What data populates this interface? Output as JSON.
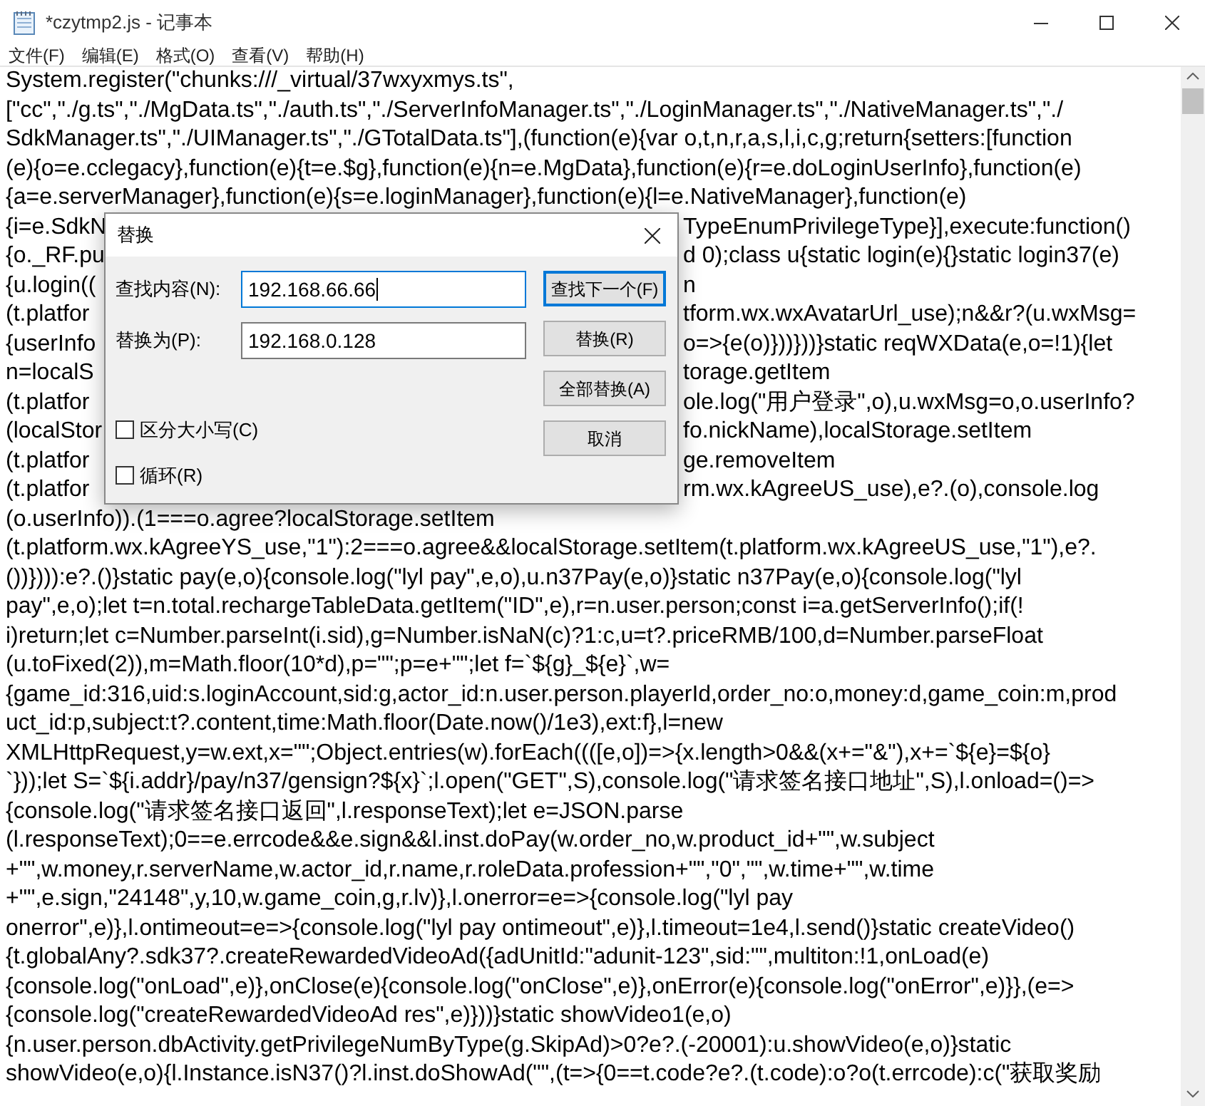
{
  "window": {
    "title": "*czytmp2.js - 记事本"
  },
  "menu": [
    "文件(F)",
    "编辑(E)",
    "格式(O)",
    "查看(V)",
    "帮助(H)"
  ],
  "editor": {
    "lines": [
      {
        "kind": "full",
        "text": "System.register(\"chunks:///_virtual/37wxyxmys.ts\","
      },
      {
        "kind": "full",
        "text": "[\"cc\",\"./g.ts\",\"./MgData.ts\",\"./auth.ts\",\"./ServerInfoManager.ts\",\"./LoginManager.ts\",\"./NativeManager.ts\",\"./"
      },
      {
        "kind": "full",
        "text": "SdkManager.ts\",\"./UIManager.ts\",\"./GTotalData.ts\"],(function(e){var o,t,n,r,a,s,l,i,c,g;return{setters:[function"
      },
      {
        "kind": "full",
        "text": "(e){o=e.cclegacy},function(e){t=e.$g},function(e){n=e.MgData},function(e){r=e.doLoginUserInfo},function(e)"
      },
      {
        "kind": "full",
        "text": "{a=e.serverManager},function(e){s=e.loginManager},function(e){l=e.NativeManager},function(e)"
      },
      {
        "kind": "split",
        "left": "{i=e.SdkN",
        "right": "TypeEnumPrivilegeType}],execute:function()"
      },
      {
        "kind": "split",
        "left": "{o._RF.pu",
        "right": "d 0);class u{static login(e){}static login37(e)"
      },
      {
        "kind": "split",
        "left": "{u.login((",
        "right": "n"
      },
      {
        "kind": "split",
        "left": "(t.platfor",
        "right": "tform.wx.wxAvatarUrl_use);n&&r?(u.wxMsg="
      },
      {
        "kind": "split",
        "left": "{userInfo",
        "right": "o=>{e(o)}))}))}static reqWXData(e,o=!1){let"
      },
      {
        "kind": "split",
        "left": "n=localS",
        "right": "torage.getItem"
      },
      {
        "kind": "split",
        "left": "(t.platfor",
        "right": "ole.log(\"用户登录\",o),u.wxMsg=o,o.userInfo?"
      },
      {
        "kind": "split",
        "left": "(localStor",
        "right": "fo.nickName),localStorage.setItem"
      },
      {
        "kind": "split",
        "left": "(t.platfor",
        "right": "ge.removeItem"
      },
      {
        "kind": "split",
        "left": "(t.platfor",
        "right": "rm.wx.kAgreeUS_use),e?.(o),console.log"
      },
      {
        "kind": "full",
        "text": "(o.userInfo)).(1===o.agree?localStorage.setItem"
      },
      {
        "kind": "full",
        "text": "(t.platform.wx.kAgreeYS_use,\"1\"):2===o.agree&&localStorage.setItem(t.platform.wx.kAgreeUS_use,\"1\"),e?."
      },
      {
        "kind": "full",
        "text": "())}))):e?.()}static pay(e,o){console.log(\"lyl pay\",e,o),u.n37Pay(e,o)}static n37Pay(e,o){console.log(\"lyl"
      },
      {
        "kind": "full",
        "text": "pay\",e,o);let t=n.total.rechargeTableData.getItem(\"ID\",e),r=n.user.person;const i=a.getServerInfo();if(!"
      },
      {
        "kind": "full",
        "text": "i)return;let c=Number.parseInt(i.sid),g=Number.isNaN(c)?1:c,u=t?.priceRMB/100,d=Number.parseFloat"
      },
      {
        "kind": "full",
        "text": "(u.toFixed(2)),m=Math.floor(10*d),p=\"\";p=e+\"\";let f=`${g}_${e}`,w="
      },
      {
        "kind": "full",
        "text": "{game_id:316,uid:s.loginAccount,sid:g,actor_id:n.user.person.playerId,order_no:o,money:d,game_coin:m,prod"
      },
      {
        "kind": "full",
        "text": "uct_id:p,subject:t?.content,time:Math.floor(Date.now()/1e3),ext:f},l=new"
      },
      {
        "kind": "full",
        "text": "XMLHttpRequest,y=w.ext,x=\"\";Object.entries(w).forEach((([e,o])=>{x.length>0&&(x+=\"&\"),x+=`${e}=${o}"
      },
      {
        "kind": "full",
        "text": "`}));let S=`${i.addr}/pay/n37/gensign?${x}`;l.open(\"GET\",S),console.log(\"请求签名接口地址\",S),l.onload=()=>"
      },
      {
        "kind": "full",
        "text": "{console.log(\"请求签名接口返回\",l.responseText);let e=JSON.parse"
      },
      {
        "kind": "full",
        "text": "(l.responseText);0==e.errcode&&e.sign&&l.inst.doPay(w.order_no,w.product_id+\"\",w.subject"
      },
      {
        "kind": "full",
        "text": "+\"\",w.money,r.serverName,w.actor_id,r.name,r.roleData.profession+\"\",\"0\",\"\",w.time+\"\",w.time"
      },
      {
        "kind": "full",
        "text": "+\"\",e.sign,\"24148\",y,10,w.game_coin,g,r.lv)},l.onerror=e=>{console.log(\"lyl pay"
      },
      {
        "kind": "full",
        "text": "onerror\",e)},l.ontimeout=e=>{console.log(\"lyl pay ontimeout\",e)},l.timeout=1e4,l.send()}static createVideo()"
      },
      {
        "kind": "full",
        "text": "{t.globalAny?.sdk37?.createRewardedVideoAd({adUnitId:\"adunit-123\",sid:\"\",multiton:!1,onLoad(e)"
      },
      {
        "kind": "full",
        "text": "{console.log(\"onLoad\",e)},onClose(e){console.log(\"onClose\",e)},onError(e){console.log(\"onError\",e)}},(e=>"
      },
      {
        "kind": "full",
        "text": "{console.log(\"createRewardedVideoAd res\",e)}))}static showVideo1(e,o)"
      },
      {
        "kind": "full",
        "text": "{n.user.person.dbActivity.getPrivilegeNumByType(g.SkipAd)>0?e?.(-20001):u.showVideo(e,o)}static"
      },
      {
        "kind": "full",
        "text": "showVideo(e,o){l.Instance.isN37()?l.inst.doShowAd(\"\",(t=>{0==t.code?e?.(t.code):o?o(t.errcode):c(\"获取奖励"
      }
    ]
  },
  "dialog": {
    "title": "替换",
    "fields": [
      {
        "label": "查找内容(N):",
        "value": "192.168.66.66",
        "focused": true
      },
      {
        "label": "替换为(P):",
        "value": "192.168.0.128",
        "focused": false
      }
    ],
    "buttons": [
      {
        "label": "查找下一个(F)",
        "default": true
      },
      {
        "label": "替换(R)",
        "default": false
      },
      {
        "label": "全部替换(A)",
        "default": false
      },
      {
        "label": "取消",
        "default": false
      }
    ],
    "checkboxes": [
      {
        "label": "区分大小写(C)",
        "checked": false
      },
      {
        "label": "循环(R)",
        "checked": false
      }
    ]
  }
}
